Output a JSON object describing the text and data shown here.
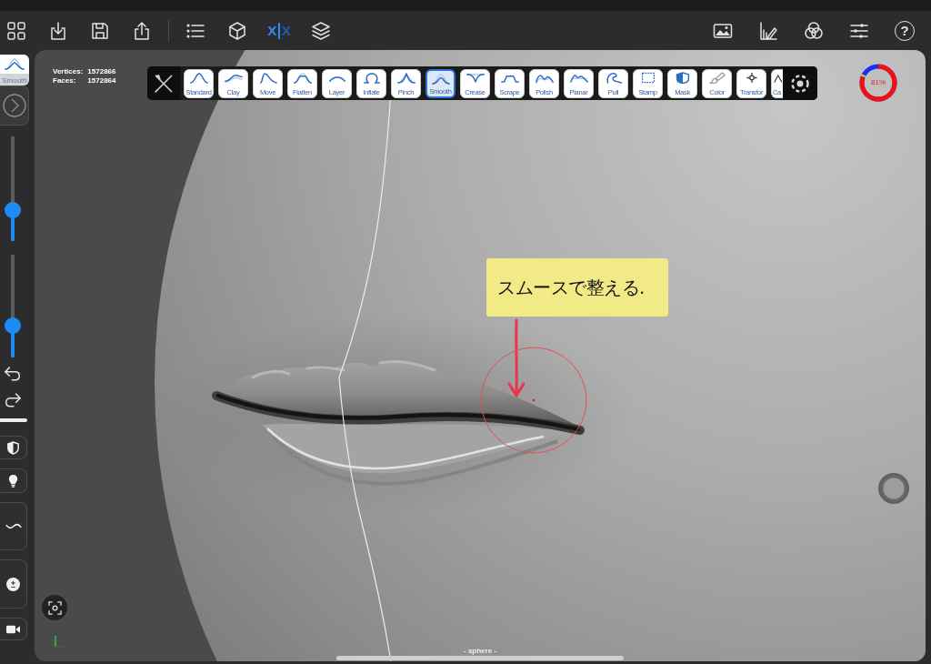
{
  "top_bar": {
    "symmetry": {
      "label": "X",
      "mirror_label": "X",
      "on": true
    },
    "help": {
      "label": "?"
    }
  },
  "side_panel": {
    "brush_label": "Smooth",
    "sliders": [
      {
        "level": 0.3
      },
      {
        "level": 0.31
      }
    ]
  },
  "viewport": {
    "stats": [
      {
        "label": "Vertices:",
        "value": "1572866"
      },
      {
        "label": "Faces:",
        "value": "1572864"
      }
    ],
    "brushes": [
      {
        "label": "Standard",
        "selected": false
      },
      {
        "label": "Clay",
        "selected": false
      },
      {
        "label": "Move",
        "selected": false
      },
      {
        "label": "Flatten",
        "selected": false
      },
      {
        "label": "Layer",
        "selected": false
      },
      {
        "label": "Inflate",
        "selected": false
      },
      {
        "label": "Pinch",
        "selected": false
      },
      {
        "label": "Smooth",
        "selected": true
      },
      {
        "label": "Crease",
        "selected": false
      },
      {
        "label": "Scrape",
        "selected": false
      },
      {
        "label": "Polish",
        "selected": false
      },
      {
        "label": "Planar",
        "selected": false
      },
      {
        "label": "Pull",
        "selected": false
      },
      {
        "label": "Stamp",
        "selected": false
      },
      {
        "label": "Mask",
        "selected": false
      },
      {
        "label": "Color",
        "selected": false
      },
      {
        "label": "Transfor",
        "selected": false
      },
      {
        "label": "Ca",
        "selected": false
      }
    ],
    "usage_indicator": {
      "reading": "81%"
    },
    "note": {
      "text": "スムースで整える."
    },
    "scene_name": "- sphere -"
  }
}
